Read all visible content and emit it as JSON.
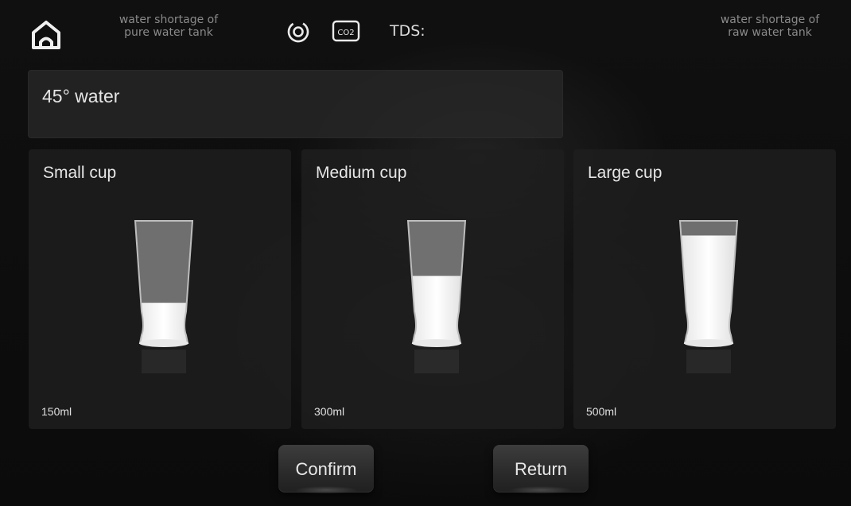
{
  "topbar": {
    "warning_pure_line1": "water shortage of",
    "warning_pure_line2": "pure water tank",
    "co2_label": "CO2",
    "tds_label": "TDS:",
    "warning_raw_line1": "water shortage of",
    "warning_raw_line2": "raw water tank"
  },
  "selection": {
    "label": "45° water"
  },
  "cups": [
    {
      "label": "Small cup",
      "volume": "150ml",
      "fill_fraction": 0.33,
      "selected": true
    },
    {
      "label": "Medium cup",
      "volume": "300ml",
      "fill_fraction": 0.55,
      "selected": false
    },
    {
      "label": "Large cup",
      "volume": "500ml",
      "fill_fraction": 0.88,
      "selected": false
    }
  ],
  "actions": {
    "confirm_label": "Confirm",
    "return_label": "Return"
  },
  "icons": {
    "home": "home-icon",
    "filter": "filter-status-icon",
    "co2": "co2-icon"
  }
}
